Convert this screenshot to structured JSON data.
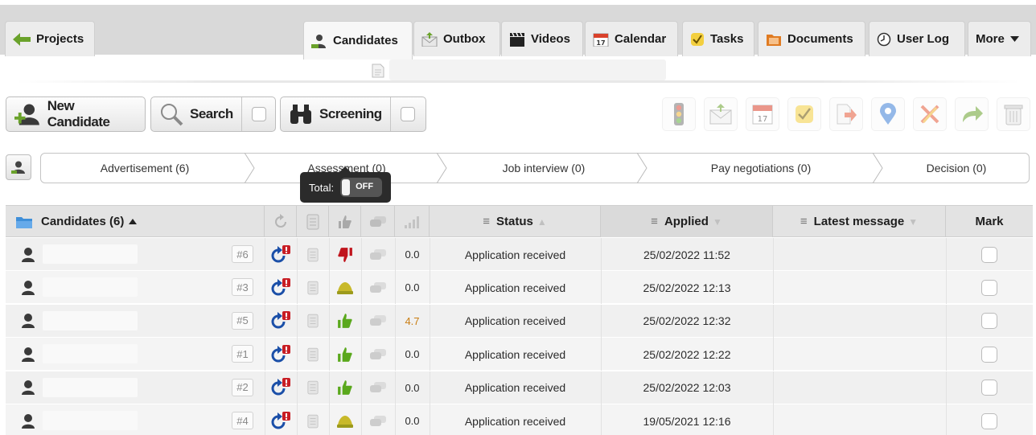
{
  "tabs": {
    "projects": "Projects",
    "candidates": "Candidates",
    "outbox": "Outbox",
    "videos": "Videos",
    "calendar": "Calendar",
    "tasks": "Tasks",
    "documents": "Documents",
    "user_log": "User Log",
    "more": "More"
  },
  "toolbar": {
    "new_candidate": "New Candidate",
    "search": "Search",
    "screening": "Screening"
  },
  "pipeline": {
    "stages": [
      "Advertisement (6)",
      "Assessment (0)",
      "Job interview (0)",
      "Pay negotiations (0)",
      "Decision (0)"
    ]
  },
  "tooltip": {
    "label": "Total:",
    "toggle": "OFF"
  },
  "table": {
    "headers": {
      "candidates": "Candidates (6)",
      "status": "Status",
      "applied": "Applied",
      "latest_message": "Latest message",
      "mark": "Mark"
    },
    "rows": [
      {
        "num": "#6",
        "rating": "down",
        "score": "0.0",
        "status": "Application received",
        "applied": "25/02/2022 11:52"
      },
      {
        "num": "#3",
        "rating": "neutral",
        "score": "0.0",
        "status": "Application received",
        "applied": "25/02/2022 12:13"
      },
      {
        "num": "#5",
        "rating": "up",
        "score": "4.7",
        "status": "Application received",
        "applied": "25/02/2022 12:32"
      },
      {
        "num": "#1",
        "rating": "up",
        "score": "0.0",
        "status": "Application received",
        "applied": "25/02/2022 12:22"
      },
      {
        "num": "#2",
        "rating": "up",
        "score": "0.0",
        "status": "Application received",
        "applied": "25/02/2022 12:03"
      },
      {
        "num": "#4",
        "rating": "neutral",
        "score": "0.0",
        "status": "Application received",
        "applied": "19/05/2021 12:16"
      }
    ]
  },
  "colors": {
    "score_highlight": "#c97d11",
    "thumb_up": "#5aa81c",
    "thumb_down": "#c0141c",
    "refresh_blue": "#1b4fa8",
    "refresh_badge": "#c81d24"
  }
}
